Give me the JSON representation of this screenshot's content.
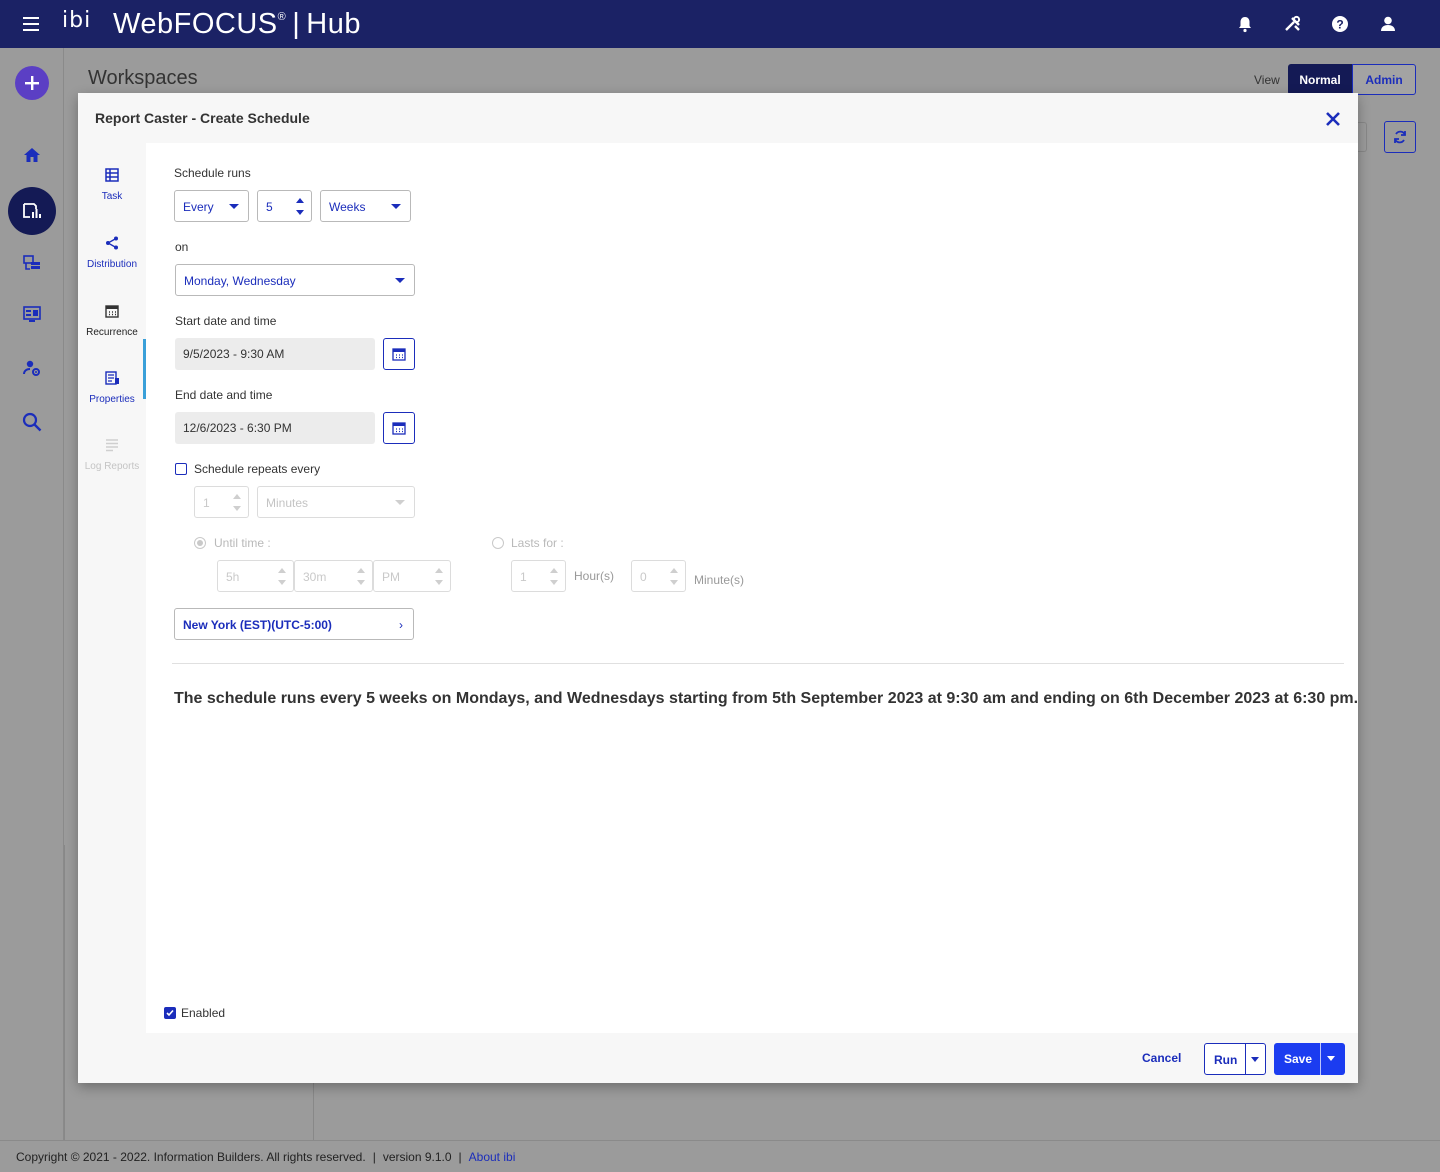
{
  "app": {
    "brand": "ibi",
    "product": "WebFOCUS",
    "trademark": "®",
    "hub": "Hub"
  },
  "header_icons": [
    "bell-icon",
    "tools-icon",
    "help-icon",
    "user-icon"
  ],
  "rail": [
    "add-icon",
    "home-icon",
    "content-icon",
    "explorer-icon",
    "portals-icon",
    "settings-icon",
    "search-icon"
  ],
  "workspace": {
    "title": "Workspaces",
    "view_label": "View",
    "view_normal": "Normal",
    "view_admin": "Admin"
  },
  "modal": {
    "title": "Report Caster - Create Schedule",
    "nav": [
      {
        "label": "Task",
        "icon": "task-icon"
      },
      {
        "label": "Distribution",
        "icon": "share-icon"
      },
      {
        "label": "Recurrence",
        "icon": "calendar-icon"
      },
      {
        "label": "Properties",
        "icon": "properties-icon"
      },
      {
        "label": "Log Reports",
        "icon": "log-icon"
      }
    ],
    "schedule_runs_label": "Schedule runs",
    "frequency": "Every",
    "interval": "5",
    "unit": "Weeks",
    "on_label": "on",
    "days": "Monday, Wednesday",
    "start_label": "Start date and time",
    "start_value": "9/5/2023 - 9:30 AM",
    "end_label": "End date and time",
    "end_value": "12/6/2023 - 6:30 PM",
    "repeats_label": "Schedule repeats every",
    "repeat_interval": "1",
    "repeat_unit": "Minutes",
    "until_time_label": "Until time :",
    "until_hours": "5h",
    "until_minutes": "30m",
    "until_ampm": "PM",
    "lasts_for_label": "Lasts for :",
    "lasts_hours": "1",
    "hours_label": "Hour(s)",
    "lasts_minutes": "0",
    "minutes_label": "Minute(s)",
    "timezone": "New York (EST)(UTC-5:00)",
    "summary": "The schedule runs every 5 weeks on Mondays, and Wednesdays starting from 5th September 2023 at 9:30 am and ending on 6th December 2023 at 6:30 pm.",
    "enabled_label": "Enabled",
    "cancel": "Cancel",
    "run": "Run",
    "save": "Save"
  },
  "footer": {
    "copyright": "Copyright © 2021 - 2022. Information Builders. All rights reserved.",
    "separator": "|",
    "version": "version 9.1.0",
    "about": "About ibi"
  },
  "colors": {
    "topbar": "#1b2265",
    "accent": "#1b2dbb",
    "primary_button": "#1b3cf0",
    "add_button": "#5b3fc4"
  }
}
